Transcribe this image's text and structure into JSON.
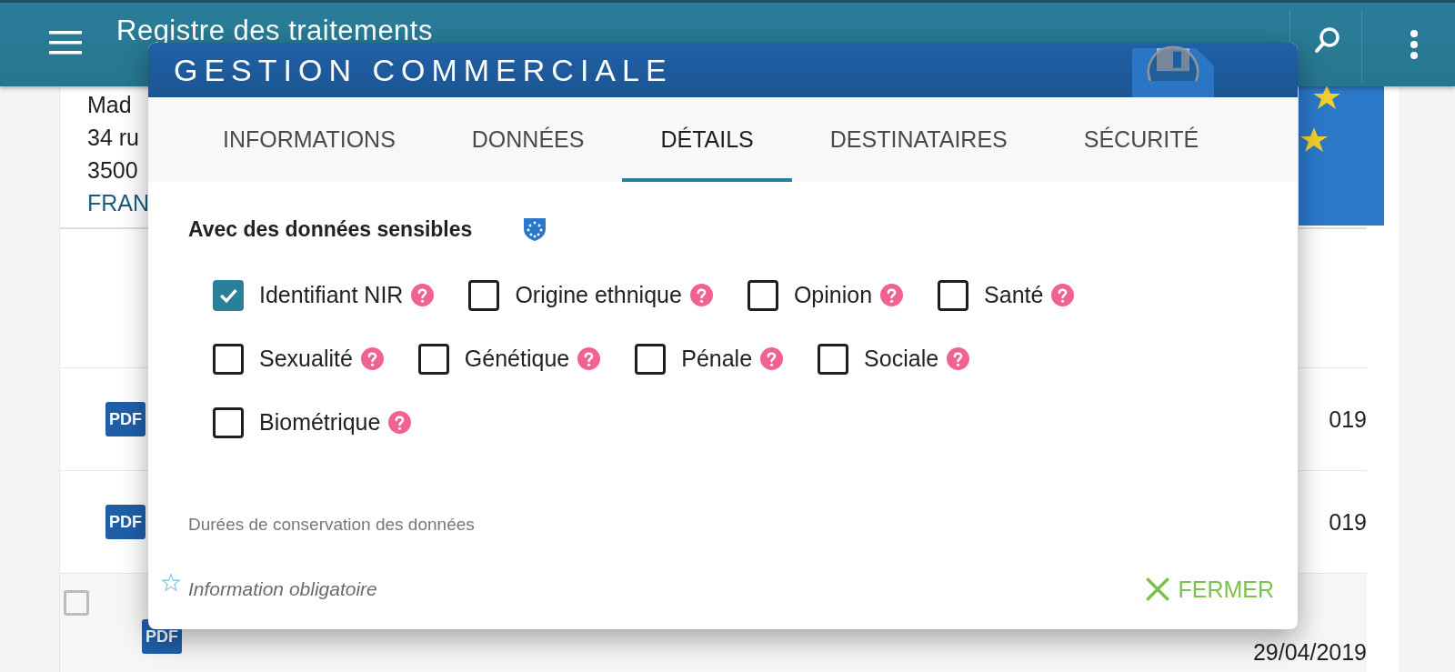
{
  "app_bar": {
    "title": "Registre des traitements"
  },
  "card": {
    "address_lines": [
      "Mad",
      "34 ru",
      "3500"
    ],
    "country": "FRAN"
  },
  "rows": [
    {
      "file_type": "PDF",
      "end_date": "019"
    },
    {
      "file_type": "PDF",
      "end_date": "019"
    },
    {
      "file_type": "PDF",
      "end_date": "29/04/2019",
      "checkbox": {
        "checked": false
      }
    }
  ],
  "dialog": {
    "title": "GESTION COMMERCIALE",
    "tabs": [
      {
        "label": "INFORMATIONS",
        "selected": false
      },
      {
        "label": "DONNÉES",
        "selected": false
      },
      {
        "label": "DÉTAILS",
        "selected": true
      },
      {
        "label": "DESTINATAIRES",
        "selected": false
      },
      {
        "label": "SÉCURITÉ",
        "selected": false
      }
    ],
    "section_title": "Avec des données sensibles",
    "option_lines": [
      [
        {
          "label": "Identifiant NIR",
          "checked": true
        },
        {
          "label": "Origine ethnique",
          "checked": false
        },
        {
          "label": "Opinion",
          "checked": false
        },
        {
          "label": "Santé",
          "checked": false
        }
      ],
      [
        {
          "label": "Sexualité",
          "checked": false
        },
        {
          "label": "Génétique",
          "checked": false
        },
        {
          "label": "Pénale",
          "checked": false
        },
        {
          "label": "Sociale",
          "checked": false
        }
      ],
      [
        {
          "label": "Biométrique",
          "checked": false
        }
      ]
    ],
    "next_section": "Durées de conservation des données",
    "required_note": "Information obligatoire",
    "close_button": "FERMER"
  }
}
